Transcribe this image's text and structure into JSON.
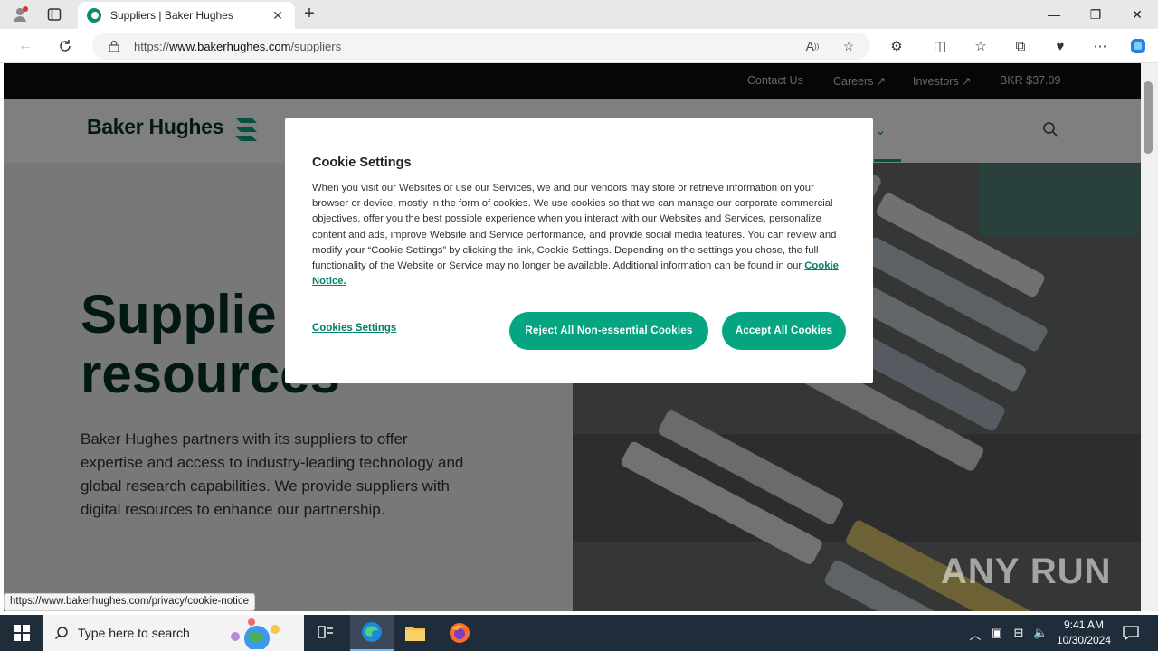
{
  "browser": {
    "tab_title": "Suppliers | Baker Hughes",
    "url_prefix": "https://",
    "url_domain": "www.bakerhughes.com",
    "url_path": "/suppliers"
  },
  "site": {
    "utility": {
      "contact": "Contact Us",
      "careers": "Careers ↗",
      "investors": "Investors ↗",
      "stock": "BKR $37.09"
    },
    "logo_text": "Baker Hughes",
    "nav_partial": "y",
    "hero": {
      "title_line1": "Supplie",
      "title_line2": "resources",
      "description": "Baker Hughes partners with its suppliers to offer expertise and access to industry-leading technology and global research capabilities. We provide suppliers with digital resources to enhance our partnership."
    },
    "status_url": "https://www.bakerhughes.com/privacy/cookie-notice",
    "watermark": "ANY RUN"
  },
  "cookie": {
    "title": "Cookie Settings",
    "body": "When you visit our Websites or use our Services, we and our vendors may store or retrieve information on your browser or device, mostly in the form of cookies. We use cookies so that we can manage our corporate commercial objectives, offer you the best possible experience when you interact with our Websites and Services, personalize content and ads, improve Website and Service performance, and provide social media features. You can review and modify your “Cookie Settings” by clicking the link, Cookie Settings. Depending on the settings you chose, the full functionality of the Website or Service may no longer be available. Additional information can be found in our ",
    "link": "Cookie Notice.",
    "settings_link": "Cookies Settings",
    "reject_btn": "Reject All Non-essential Cookies",
    "accept_btn": "Accept All Cookies"
  },
  "taskbar": {
    "search_placeholder": "Type here to search",
    "time": "9:41 AM",
    "date": "10/30/2024"
  },
  "colors": {
    "accent": "#06a581",
    "brand_dark": "#02302a"
  }
}
